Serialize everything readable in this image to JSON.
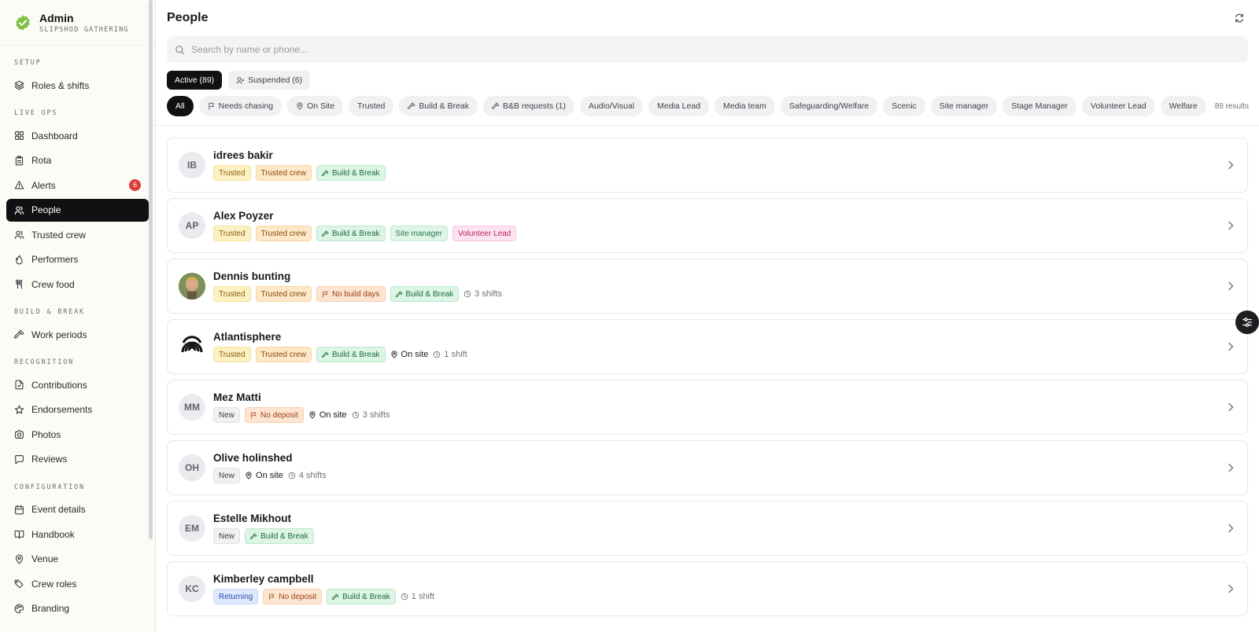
{
  "brand": {
    "title": "Admin",
    "subtitle": "SLIPSHOD GATHERING"
  },
  "sidebar": {
    "sections": [
      {
        "label": "SETUP",
        "items": [
          {
            "label": "Roles & shifts",
            "icon": "layers-icon"
          }
        ]
      },
      {
        "label": "LIVE OPS",
        "items": [
          {
            "label": "Dashboard",
            "icon": "grid-icon"
          },
          {
            "label": "Rota",
            "icon": "clipboard-icon"
          },
          {
            "label": "Alerts",
            "icon": "warning-icon",
            "badge": "6"
          },
          {
            "label": "People",
            "icon": "users-icon",
            "active": true
          },
          {
            "label": "Trusted crew",
            "icon": "users-icon"
          },
          {
            "label": "Performers",
            "icon": "flame-icon"
          },
          {
            "label": "Crew food",
            "icon": "utensils-icon"
          }
        ]
      },
      {
        "label": "BUILD & BREAK",
        "items": [
          {
            "label": "Work periods",
            "icon": "hammer-icon"
          }
        ]
      },
      {
        "label": "RECOGNITION",
        "items": [
          {
            "label": "Contributions",
            "icon": "file-icon"
          },
          {
            "label": "Endorsements",
            "icon": "star-icon"
          },
          {
            "label": "Photos",
            "icon": "camera-icon"
          },
          {
            "label": "Reviews",
            "icon": "message-icon"
          }
        ]
      },
      {
        "label": "CONFIGURATION",
        "items": [
          {
            "label": "Event details",
            "icon": "calendar-icon"
          },
          {
            "label": "Handbook",
            "icon": "book-icon"
          },
          {
            "label": "Venue",
            "icon": "pin-icon"
          },
          {
            "label": "Crew roles",
            "icon": "tags-icon"
          },
          {
            "label": "Branding",
            "icon": "palette-icon"
          }
        ]
      }
    ]
  },
  "page": {
    "title": "People"
  },
  "search": {
    "placeholder": "Search by name or phone..."
  },
  "tabs": [
    {
      "label": "Active (89)",
      "active": true
    },
    {
      "label": "Suspended (6)",
      "active": false
    }
  ],
  "filters": [
    {
      "label": "All",
      "active": true
    },
    {
      "label": "Needs chasing",
      "icon": "flag-icon"
    },
    {
      "label": "On Site",
      "icon": "pin-icon"
    },
    {
      "label": "Trusted"
    },
    {
      "label": "Build & Break",
      "icon": "hammer-icon"
    },
    {
      "label": "B&B requests (1)",
      "icon": "hammer-icon"
    },
    {
      "label": "Audio/Visual"
    },
    {
      "label": "Media Lead"
    },
    {
      "label": "Media team"
    },
    {
      "label": "Safeguarding/Welfare"
    },
    {
      "label": "Scenic"
    },
    {
      "label": "Site manager"
    },
    {
      "label": "Stage Manager"
    },
    {
      "label": "Volunteer Lead"
    },
    {
      "label": "Welfare"
    }
  ],
  "results_count": "89 results",
  "people": [
    {
      "name": "idrees bakir",
      "initials": "IB",
      "tags": [
        {
          "label": "Trusted",
          "kind": "t-trusted"
        },
        {
          "label": "Trusted crew",
          "kind": "t-crew"
        },
        {
          "label": "Build & Break",
          "kind": "t-bb",
          "icon": "hammer-icon"
        }
      ],
      "meta": []
    },
    {
      "name": "Alex Poyzer",
      "initials": "AP",
      "tags": [
        {
          "label": "Trusted",
          "kind": "t-trusted"
        },
        {
          "label": "Trusted crew",
          "kind": "t-crew"
        },
        {
          "label": "Build & Break",
          "kind": "t-bb",
          "icon": "hammer-icon"
        },
        {
          "label": "Site manager",
          "kind": "t-site"
        },
        {
          "label": "Volunteer Lead",
          "kind": "t-lead"
        }
      ],
      "meta": []
    },
    {
      "name": "Dennis bunting",
      "initials": "",
      "photo": "photo-avatar",
      "tags": [
        {
          "label": "Trusted",
          "kind": "t-trusted"
        },
        {
          "label": "Trusted crew",
          "kind": "t-crew"
        },
        {
          "label": "No build days",
          "kind": "t-nobuild",
          "icon": "flag-icon"
        },
        {
          "label": "Build & Break",
          "kind": "t-bb",
          "icon": "hammer-icon"
        }
      ],
      "meta": [
        {
          "label": "3 shifts",
          "icon": "clock-icon"
        }
      ]
    },
    {
      "name": "Atlantisphere",
      "initials": "",
      "photo": "logo-avatar",
      "tags": [
        {
          "label": "Trusted",
          "kind": "t-trusted"
        },
        {
          "label": "Trusted crew",
          "kind": "t-crew"
        },
        {
          "label": "Build & Break",
          "kind": "t-bb",
          "icon": "hammer-icon"
        }
      ],
      "meta": [
        {
          "label": "On site",
          "icon": "pin-icon",
          "dark": true
        },
        {
          "label": "1 shift",
          "icon": "clock-icon"
        }
      ]
    },
    {
      "name": "Mez Matti",
      "initials": "MM",
      "tags": [
        {
          "label": "New",
          "kind": "t-new"
        },
        {
          "label": "No deposit",
          "kind": "t-nodep",
          "icon": "flag-icon"
        }
      ],
      "meta": [
        {
          "label": "On site",
          "icon": "pin-icon",
          "dark": true
        },
        {
          "label": "3 shifts",
          "icon": "clock-icon"
        }
      ]
    },
    {
      "name": "Olive holinshed",
      "initials": "OH",
      "tags": [
        {
          "label": "New",
          "kind": "t-new"
        }
      ],
      "meta": [
        {
          "label": "On site",
          "icon": "pin-icon",
          "dark": true
        },
        {
          "label": "4 shifts",
          "icon": "clock-icon"
        }
      ]
    },
    {
      "name": "Estelle Mikhout",
      "initials": "EM",
      "tags": [
        {
          "label": "New",
          "kind": "t-new"
        },
        {
          "label": "Build & Break",
          "kind": "t-bb",
          "icon": "hammer-icon"
        }
      ],
      "meta": []
    },
    {
      "name": "Kimberley campbell",
      "initials": "KC",
      "tags": [
        {
          "label": "Returning",
          "kind": "t-ret"
        },
        {
          "label": "No deposit",
          "kind": "t-nodep",
          "icon": "flag-icon"
        },
        {
          "label": "Build & Break",
          "kind": "t-bb",
          "icon": "hammer-icon"
        }
      ],
      "meta": [
        {
          "label": "1 shift",
          "icon": "clock-icon"
        }
      ]
    }
  ],
  "colors": {
    "accent": "#111113",
    "brand_check": "#7cc242",
    "alert_badge": "#dc3b3b"
  }
}
